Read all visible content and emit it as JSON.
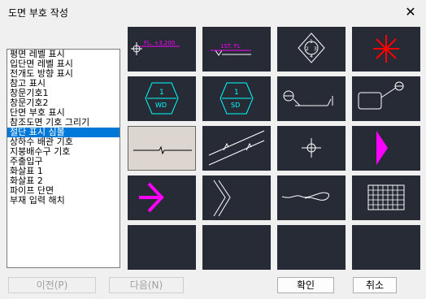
{
  "window": {
    "title": "도면 부호 작성",
    "close_glyph": "✕"
  },
  "list": {
    "items": [
      "평면 레벨 표시",
      "입단면 레벨 표시",
      "전개도 방향 표시",
      "참고 표시",
      "창문기호1",
      "창문기호2",
      "단면 부호 표시",
      "참조도면 기호 그리기",
      "절단 표시 심볼",
      "상하수 배관 기호",
      "지붕배수구 기호",
      "주출입구",
      "화살표 1",
      "화살표 2",
      "파이프 단면",
      "부재 입력 해치"
    ],
    "selected_index": 8
  },
  "symbols": {
    "level_label": "FL. +3,200",
    "floor_label": "1ST. FL",
    "diamond_numbers": [
      "1",
      "2",
      "3",
      "4"
    ],
    "window_top_1": "1",
    "window_bottom_1": "WD",
    "window_top_2": "1",
    "window_bottom_2": "SD"
  },
  "buttons": {
    "prev": "이전(P)",
    "next": "다음(N)",
    "ok": "확인",
    "cancel": "취소"
  },
  "colors": {
    "selection": "#0078d7",
    "tile_bg": "#262b35",
    "magenta": "#ff00ff",
    "cyan": "#00ffff",
    "red": "#ff0000"
  }
}
